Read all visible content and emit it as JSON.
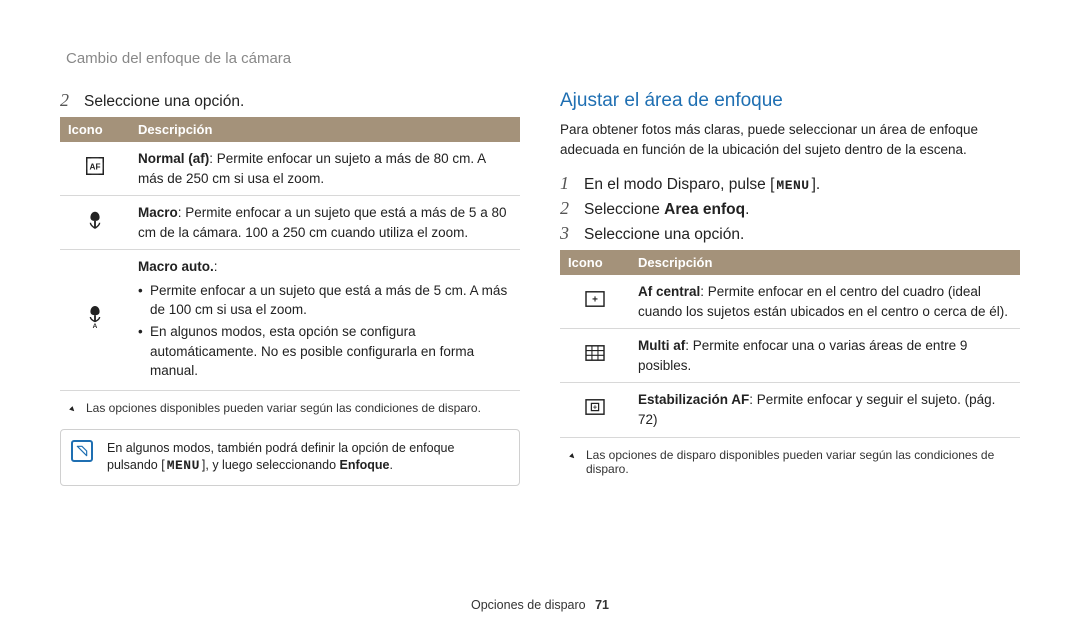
{
  "header": {
    "title": "Cambio del enfoque de la cámara"
  },
  "left": {
    "step2": {
      "num": "2",
      "text": "Seleccione una opción."
    },
    "table": {
      "head_icon": "Icono",
      "head_desc": "Descripción",
      "rows": [
        {
          "icon": "af-normal",
          "strong": "Normal (af)",
          "body": ": Permite enfocar un sujeto a más de 80 cm. A más de 250 cm si usa el zoom."
        },
        {
          "icon": "macro",
          "strong": "Macro",
          "body": ": Permite enfocar a un sujeto que está a más de 5 a 80 cm de la cámara. 100 a 250 cm cuando utiliza el zoom."
        },
        {
          "icon": "macro-auto",
          "strong": "Macro auto.",
          "body": ":",
          "bullets": [
            "Permite enfocar a un sujeto que está a más de 5 cm. A más de 100 cm si usa el zoom.",
            "En algunos modos, esta opción se configura automáticamente. No es posible configurarla en forma manual."
          ]
        }
      ]
    },
    "caption": "Las opciones disponibles pueden variar según las condiciones de disparo.",
    "note": {
      "pre": "En algunos modos, también podrá definir la opción de enfoque pulsando [",
      "menu": "MENU",
      "post": "], y luego seleccionando ",
      "bold": "Enfoque",
      "suffix": "."
    }
  },
  "right": {
    "title": "Ajustar el área de enfoque",
    "intro": "Para obtener fotos más claras, puede seleccionar un área de enfoque adecuada en función de la ubicación del sujeto dentro de la escena.",
    "steps": [
      {
        "num": "1",
        "pre": "En el modo Disparo, pulse [",
        "menu": "MENU",
        "post": "]."
      },
      {
        "num": "2",
        "pre": "Seleccione ",
        "bold": "Area enfoq",
        "post": "."
      },
      {
        "num": "3",
        "text": "Seleccione una opción."
      }
    ],
    "table": {
      "head_icon": "Icono",
      "head_desc": "Descripción",
      "rows": [
        {
          "icon": "af-center",
          "strong": "Af central",
          "body": ": Permite enfocar en el centro del cuadro (ideal cuando los sujetos están ubicados en el centro o cerca de él)."
        },
        {
          "icon": "af-multi",
          "strong": "Multi af",
          "body": ": Permite enfocar una o varias áreas de entre 9 posibles."
        },
        {
          "icon": "af-track",
          "strong": "Estabilización AF",
          "body": ": Permite enfocar y seguir el sujeto. (pág. 72)"
        }
      ]
    },
    "caption": "Las opciones de disparo disponibles pueden variar según las condiciones de disparo."
  },
  "footer": {
    "label": "Opciones de disparo",
    "page": "71"
  }
}
